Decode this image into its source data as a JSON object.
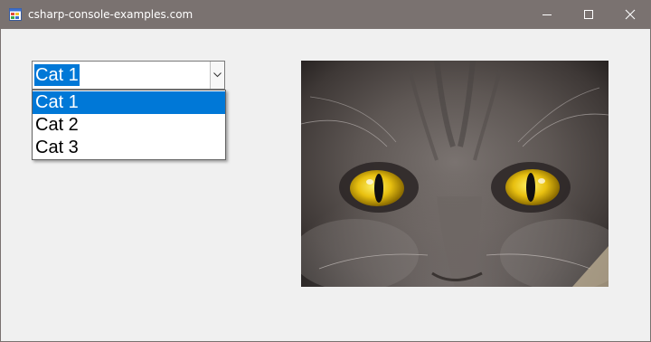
{
  "window": {
    "title": "csharp-console-examples.com",
    "icon": "winforms-app-icon",
    "controls": [
      "minimize-icon",
      "maximize-icon",
      "close-icon"
    ]
  },
  "combobox": {
    "selected": "Cat 1",
    "options": [
      "Cat 1",
      "Cat 2",
      "Cat 3"
    ],
    "highlighted_index": 0
  },
  "picture": {
    "subject": "close-up of a gray cat's face with yellow eyes"
  },
  "colors": {
    "titlebar": "#7a7270",
    "selection": "#0078d7",
    "form_background": "#f0f0f0"
  }
}
